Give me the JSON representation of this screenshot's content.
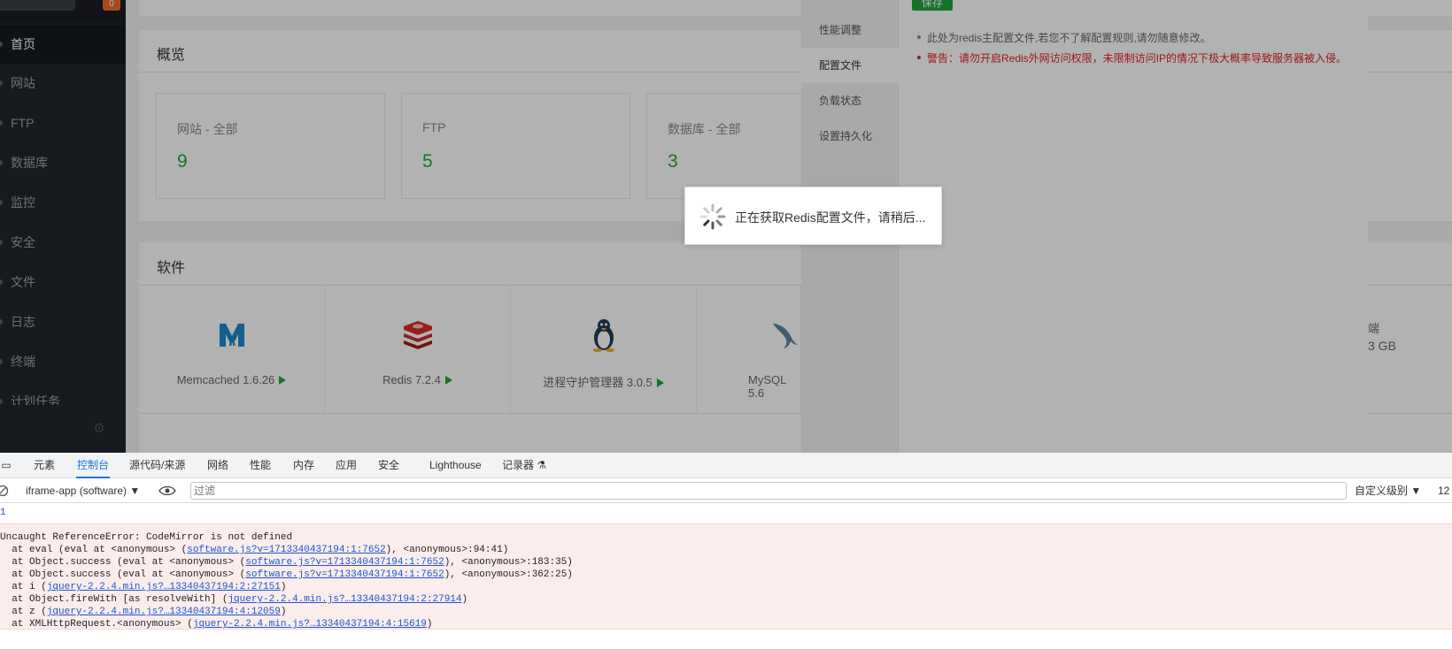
{
  "sidebar": {
    "badge": "0",
    "items": [
      {
        "label": "首页",
        "active": true
      },
      {
        "label": "网站"
      },
      {
        "label": "FTP"
      },
      {
        "label": "数据库"
      },
      {
        "label": "监控"
      },
      {
        "label": "安全"
      },
      {
        "label": "文件"
      },
      {
        "label": "日志"
      },
      {
        "label": "终端"
      },
      {
        "label": "计划任务"
      }
    ]
  },
  "overview": {
    "title": "概览",
    "cards": [
      {
        "label": "网站 - 全部",
        "value": "9"
      },
      {
        "label": "FTP",
        "value": "5"
      },
      {
        "label": "数据库 - 全部",
        "value": "3"
      }
    ]
  },
  "software": {
    "title": "软件",
    "items": [
      {
        "name": "Memcached 1.6.26",
        "icon": "memcached-icon"
      },
      {
        "name": "Redis 7.2.4",
        "icon": "redis-icon"
      },
      {
        "name": "进程守护管理器 3.0.5",
        "icon": "linux-penguin-icon"
      },
      {
        "name": "MySQL 5.6",
        "icon": "mysql-dolphin-icon"
      }
    ],
    "right_partial_1": "端",
    "right_partial_2": "3 GB"
  },
  "modal": {
    "save_label": "保存",
    "tabs": [
      "性能调整",
      "配置文件",
      "负载状态",
      "设置持久化"
    ],
    "active_tab": "配置文件",
    "tip": "此处为redis主配置文件,若您不了解配置规则,请勿随意修改。",
    "warning": "警告：请勿开启Redis外网访问权限，未限制访问IP的情况下极大概率导致服务器被入侵。"
  },
  "loading": {
    "message": "正在获取Redis配置文件，请稍后..."
  },
  "devtools": {
    "tabs": [
      "元素",
      "控制台",
      "源代码/来源",
      "网络",
      "性能",
      "内存",
      "应用",
      "安全",
      "Lighthouse",
      "记录器"
    ],
    "active_tab": "控制台",
    "context": "iframe-app (software)",
    "filter_placeholder": "过滤",
    "level": "自定义级别 ▼",
    "count": "12",
    "first_line": "1",
    "error_title": "Uncaught ReferenceError: CodeMirror is not defined",
    "stack": [
      {
        "pre": "  at eval (eval at <anonymous> (",
        "link": "software.js?v=1713340437194:1:7652",
        "post": "), <anonymous>:94:41)"
      },
      {
        "pre": "  at Object.success (eval at <anonymous> (",
        "link": "software.js?v=1713340437194:1:7652",
        "post": "), <anonymous>:183:35)"
      },
      {
        "pre": "  at Object.success (eval at <anonymous> (",
        "link": "software.js?v=1713340437194:1:7652",
        "post": "), <anonymous>:362:25)"
      },
      {
        "pre": "  at i (",
        "link": "jquery-2.2.4.min.js?…13340437194:2:27151",
        "post": ")"
      },
      {
        "pre": "  at Object.fireWith [as resolveWith] (",
        "link": "jquery-2.2.4.min.js?…13340437194:2:27914",
        "post": ")"
      },
      {
        "pre": "  at z (",
        "link": "jquery-2.2.4.min.js?…13340437194:4:12059",
        "post": ")"
      },
      {
        "pre": "  at XMLHttpRequest.<anonymous> (",
        "link": "jquery-2.2.4.min.js?…13340437194:4:15619",
        "post": ")"
      }
    ]
  }
}
